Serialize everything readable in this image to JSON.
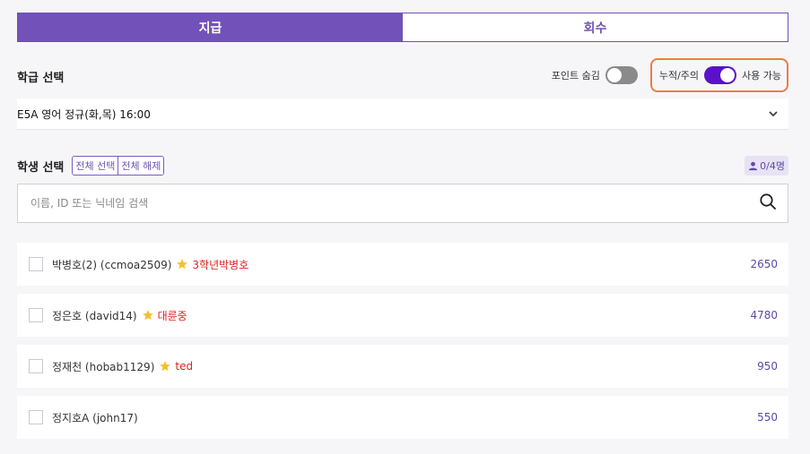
{
  "tabs": [
    {
      "label": "지급",
      "active": true
    },
    {
      "label": "회수",
      "active": false
    }
  ],
  "class_section": {
    "title": "학급 선택",
    "hide_points_label": "포인트 숨김",
    "hide_points_on": false,
    "cumulative_label": "누적/주의",
    "cumulative_on": true,
    "usable_label": "사용 가능",
    "selected_class": "E5A 영어 정규(화,목) 16:00"
  },
  "student_section": {
    "title": "학생 선택",
    "select_all_label": "전체 선택",
    "deselect_all_label": "전체 해제",
    "count_label": "0/4명",
    "search_placeholder": "이름, ID 또는 닉네임 검색"
  },
  "students": [
    {
      "name": "박병호(2) (ccmoa2509)",
      "tag": "3학년박병호",
      "points": "2650"
    },
    {
      "name": "정은호 (david14)",
      "tag": "대륜중",
      "points": "4780"
    },
    {
      "name": "정재천 (hobab1129)",
      "tag": "ted",
      "points": "950"
    },
    {
      "name": "정지호A (john17)",
      "tag": "",
      "points": "550"
    }
  ],
  "colors": {
    "accent": "#7252b8",
    "toggle_on": "#5a12c8",
    "highlight": "#f07b43",
    "tag_red": "#e02020",
    "star": "#f2c230"
  }
}
